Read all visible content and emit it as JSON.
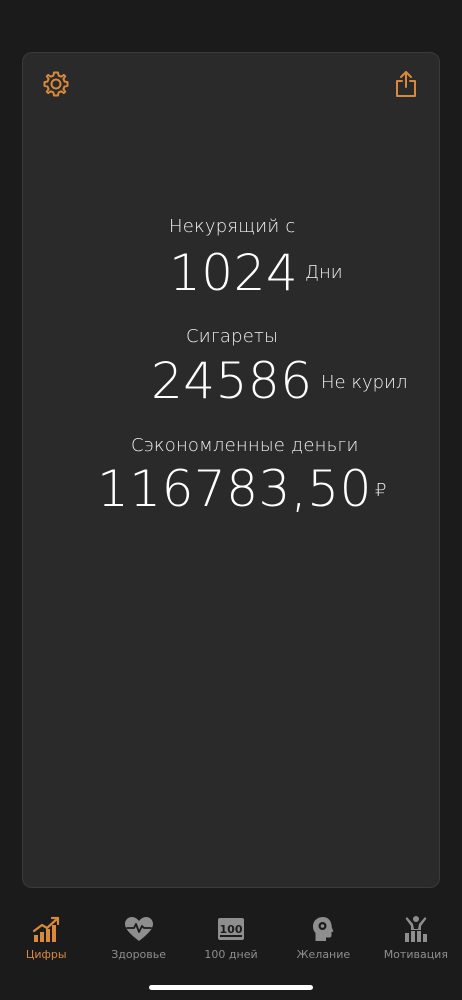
{
  "colors": {
    "accent": "#d8893c",
    "background": "#1b1b1b",
    "card": "#2a2a2a",
    "text": "#ffffff",
    "tab_inactive": "#8e8e8e"
  },
  "header": {
    "settings_icon": "gear-icon",
    "share_icon": "share-icon"
  },
  "stats": {
    "smoke_free": {
      "label": "Некурящий с",
      "value": "1024",
      "unit": "Дни"
    },
    "cigarettes": {
      "label": "Сигареты",
      "value": "24586",
      "unit": "Не курил"
    },
    "money": {
      "label": "Сэкономленные деньги",
      "value": "116783,50",
      "unit": "₽"
    }
  },
  "tabs": [
    {
      "label": "Цифры",
      "icon": "chart-icon",
      "active": true
    },
    {
      "label": "Здоровье",
      "icon": "heart-pulse-icon",
      "active": false
    },
    {
      "label": "100 дней",
      "icon": "hundred-icon",
      "active": false
    },
    {
      "label": "Желание",
      "icon": "head-icon",
      "active": false
    },
    {
      "label": "Мотивация",
      "icon": "motivation-icon",
      "active": false
    }
  ]
}
